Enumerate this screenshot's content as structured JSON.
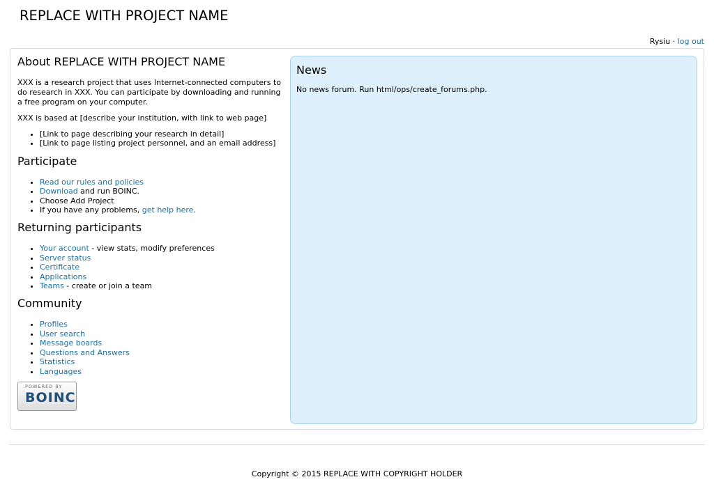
{
  "header": {
    "title": "REPLACE WITH PROJECT NAME",
    "user": "Rysiu",
    "sep": "·",
    "logout": "log out"
  },
  "about": {
    "heading": "About REPLACE WITH PROJECT NAME",
    "p1": "XXX is a research project that uses Internet-connected computers to do research in XXX. You can participate by downloading and running a free program on your computer.",
    "p2": "XXX is based at [describe your institution, with link to web page]",
    "items": [
      "[Link to page describing your research in detail]",
      "[Link to page listing project personnel, and an email address]"
    ]
  },
  "participate": {
    "heading": "Participate",
    "rules": "Read our rules and policies",
    "download": "Download",
    "download_rest": " and run BOINC.",
    "choose": "Choose Add Project",
    "problems": "If you have any problems, ",
    "help": "get help here",
    "period": "."
  },
  "returning": {
    "heading": "Returning participants",
    "account": "Your account",
    "account_rest": " - view stats, modify preferences",
    "server": "Server status",
    "certificate": "Certificate",
    "applications": "Applications",
    "teams": "Teams",
    "teams_rest": " - create or join a team"
  },
  "community": {
    "heading": "Community",
    "items": [
      "Profiles",
      "User search",
      "Message boards",
      "Questions and Answers",
      "Statistics",
      "Languages"
    ]
  },
  "badge": {
    "top": "POWERED BY",
    "logo": "BOINC"
  },
  "news": {
    "heading": "News",
    "text": "No news forum. Run html/ops/create_forums.php."
  },
  "footer": {
    "copyright": "Copyright © 2015 REPLACE WITH COPYRIGHT HOLDER"
  }
}
